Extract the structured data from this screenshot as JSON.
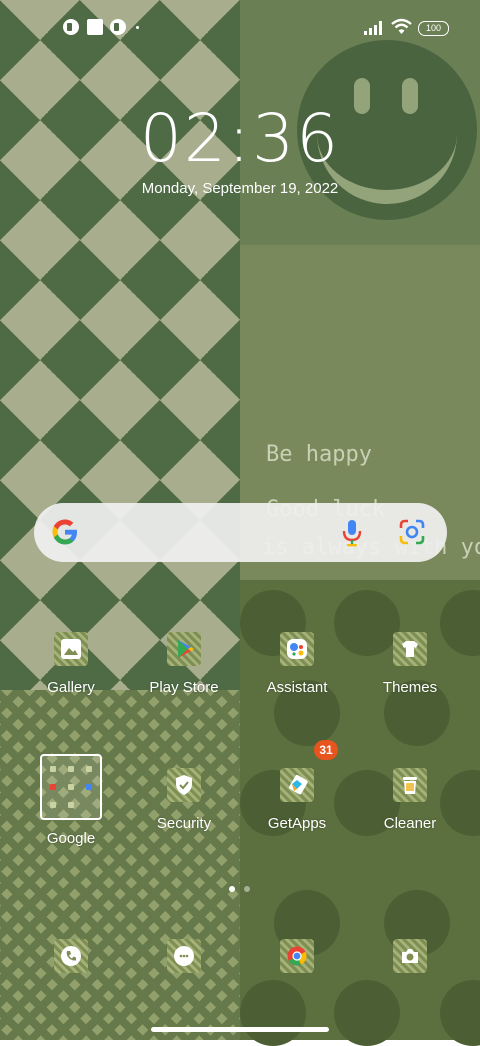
{
  "status_bar": {
    "notification_icons": [
      "notification-icon-a",
      "notification-square-icon",
      "notification-icon-b"
    ],
    "battery_level": "100",
    "signal_icon": "signal-bars-icon",
    "wifi_icon": "wifi-icon"
  },
  "lockscreen": {
    "time": "02:36",
    "date": "Monday, September 19, 2022"
  },
  "wallpaper": {
    "text_line1": "Be happy",
    "text_line2": "Good luck",
    "text_line3": "is always with you"
  },
  "search_bar": {
    "logo": "google-logo-icon",
    "mic_icon": "microphone-icon",
    "lens_icon": "google-lens-icon"
  },
  "apps_row1": [
    {
      "label": "Gallery",
      "icon": "gallery-icon"
    },
    {
      "label": "Play Store",
      "icon": "play-store-icon"
    },
    {
      "label": "Assistant",
      "icon": "assistant-icon"
    },
    {
      "label": "Themes",
      "icon": "themes-icon"
    }
  ],
  "apps_row2": [
    {
      "label": "Google",
      "icon": "folder-icon"
    },
    {
      "label": "Security",
      "icon": "security-shield-icon"
    },
    {
      "label": "GetApps",
      "icon": "getapps-icon",
      "badge": "31"
    },
    {
      "label": "Cleaner",
      "icon": "cleaner-icon"
    }
  ],
  "dock": [
    {
      "icon": "phone-icon"
    },
    {
      "icon": "messages-icon"
    },
    {
      "icon": "chrome-icon"
    },
    {
      "icon": "camera-icon"
    }
  ],
  "page_indicator": {
    "pages": 2,
    "current": 1
  },
  "colors": {
    "badge": "#e8541e",
    "dark_green": "#4e6b45",
    "light_khaki": "#a7ad8d"
  }
}
